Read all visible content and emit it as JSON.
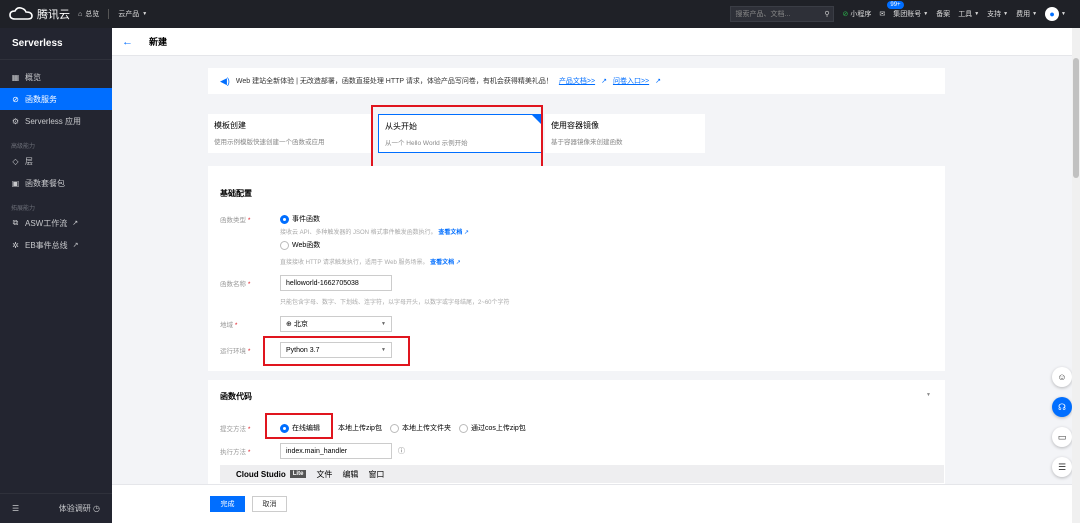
{
  "topbar": {
    "brand": "腾讯云",
    "overview": "总览",
    "products": "云产品",
    "search_placeholder": "搜索产品、文档...",
    "mini_program": "小程序",
    "message_badge": "99+",
    "group_account": "集团账号",
    "filing": "备案",
    "tools": "工具",
    "support": "支持",
    "billing": "费用"
  },
  "sidebar": {
    "title": "Serverless",
    "items": [
      {
        "label": "概览"
      },
      {
        "label": "函数服务"
      },
      {
        "label": "Serverless 应用"
      }
    ],
    "group_advanced": "高级能力",
    "advanced_items": [
      {
        "label": "层"
      },
      {
        "label": "函数套餐包"
      }
    ],
    "group_extend": "拓展能力",
    "extend_items": [
      {
        "label": "ASW工作流"
      },
      {
        "label": "EB事件总线"
      }
    ],
    "bottom_label": "体验调研"
  },
  "header": {
    "title": "新建"
  },
  "notice": {
    "text": "Web 建站全新体验 | 无改造部署，函数直接处理 HTTP 请求，体验产品写问卷，有机会获得精美礼品！",
    "link_docs": "产品文档>>",
    "link_survey": "问卷入口>>"
  },
  "templates": [
    {
      "title": "模板创建",
      "desc": "使用示例模版快速创建一个函数或应用"
    },
    {
      "title": "从头开始",
      "desc": "从一个 Hello World 示例开始"
    },
    {
      "title": "使用容器镜像",
      "desc": "基于容器镜像来创建函数"
    }
  ],
  "basic": {
    "title": "基础配置",
    "func_type_label": "函数类型",
    "type_event": "事件函数",
    "type_event_hint": "接收云 API、多种触发器的 JSON 格式事件触发函数执行。",
    "type_web": "Web函数",
    "type_web_hint": "直接接收 HTTP 请求触发执行，适用于 Web 服务场景。",
    "doc_link": "查看文档",
    "name_label": "函数名称",
    "name_value": "helloworld-1662705038",
    "name_hint": "只能包含字母、数字、下划线、连字符，以字母开头，以数字或字母结尾，2~60个字符",
    "region_label": "地域",
    "region_value": "北京",
    "runtime_label": "运行环境",
    "runtime_value": "Python 3.7"
  },
  "code": {
    "title": "函数代码",
    "submit_label": "提交方法",
    "submit_options": [
      "在线编辑",
      "本地上传zip包",
      "本地上传文件夹",
      "通过cos上传zip包"
    ],
    "handler_label": "执行方法",
    "handler_value": "index.main_handler",
    "editor_name": "Cloud Studio",
    "editor_badge": "Lite",
    "editor_menu": [
      "文件",
      "编辑",
      "窗口"
    ]
  },
  "footer": {
    "done": "完成",
    "cancel": "取消"
  },
  "colors": {
    "accent": "#006eff",
    "highlight": "#e0151e",
    "sidebar": "#232530",
    "topbar": "#1f2127"
  }
}
